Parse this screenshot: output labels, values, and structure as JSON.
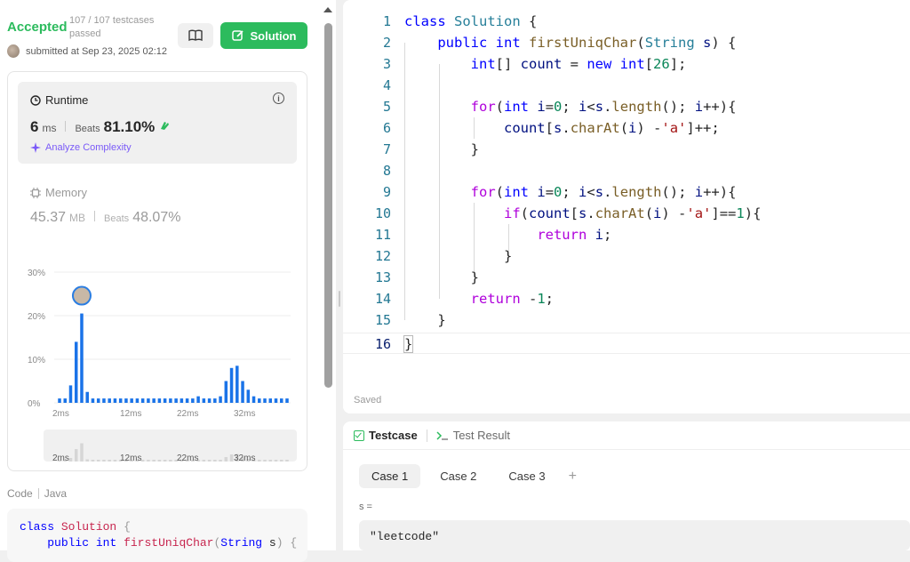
{
  "submission": {
    "status": "Accepted",
    "testcases": "107 / 107 testcases passed",
    "submitted": "submitted at Sep 23, 2025 02:12",
    "solution_label": "Solution"
  },
  "runtime": {
    "title": "Runtime",
    "value": "6",
    "unit": "ms",
    "beats_label": "Beats",
    "beats": "81.10%",
    "analyze": "Analyze Complexity"
  },
  "memory": {
    "title": "Memory",
    "value": "45.37",
    "unit": "MB",
    "beats_label": "Beats",
    "beats": "48.07%"
  },
  "chart_data": {
    "type": "bar",
    "y_ticks": [
      "30%",
      "20%",
      "10%",
      "0%"
    ],
    "ylim": [
      0,
      30
    ],
    "x_ticks": [
      "2ms",
      "12ms",
      "22ms",
      "32ms"
    ],
    "values": [
      1,
      1,
      4,
      14,
      20.5,
      2.5,
      1,
      1,
      1,
      1,
      1,
      1,
      1,
      1,
      1,
      1,
      1,
      1,
      1,
      1,
      1,
      1,
      1,
      1,
      1,
      1.5,
      1,
      1,
      1,
      1.5,
      5,
      8,
      8.5,
      5,
      3,
      1.5,
      1,
      1,
      1,
      1,
      1,
      1
    ],
    "highlight_index": 4,
    "overview_ticks": [
      "2ms",
      "12ms",
      "22ms",
      "32ms"
    ]
  },
  "code_panel": {
    "label": "Code",
    "lang": "Java",
    "preview_lines": [
      "class Solution {",
      "    public int firstUniqChar(String s) {"
    ]
  },
  "editor": {
    "status": "Saved"
  },
  "testpanel": {
    "tab_testcase": "Testcase",
    "tab_result": "Test Result",
    "cases": [
      "Case 1",
      "Case 2",
      "Case 3"
    ],
    "plus": "+",
    "var_label": "s =",
    "var_value": "\"leetcode\""
  }
}
